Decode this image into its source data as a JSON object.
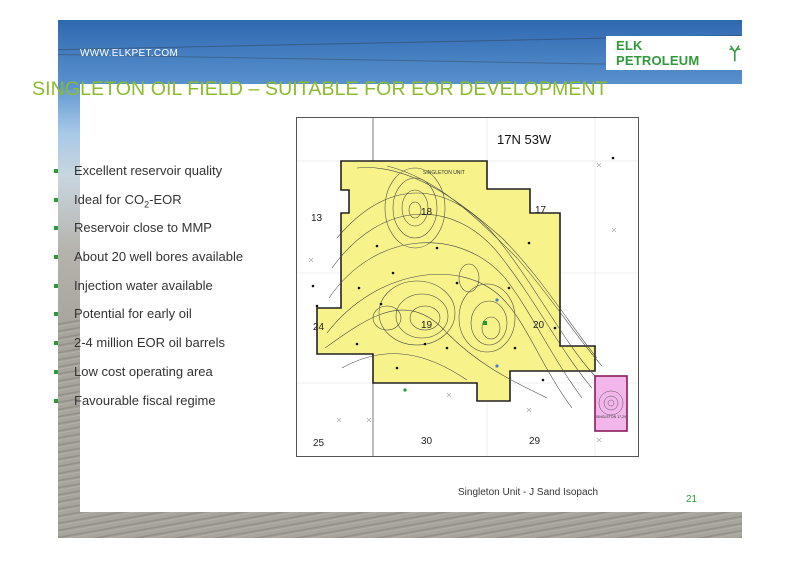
{
  "website": "WWW.ELKPET.COM",
  "logo": {
    "text": "ELK PETROLEUM"
  },
  "title": "SINGLETON OIL FIELD – SUITABLE FOR EOR DEVELOPMENT",
  "bullets": {
    "b0": "Excellent reservoir quality",
    "b1_pre": "Ideal for CO",
    "b1_sub": "2",
    "b1_post": "-EOR",
    "b2": "Reservoir close to MMP",
    "b3": "About 20 well bores available",
    "b4": "Injection water available",
    "b5": "Potential for early oil",
    "b6": "2-4 million EOR oil barrels",
    "b7": "Low cost operating area",
    "b8": "Favourable fiscal regime"
  },
  "map": {
    "township": "17N 53W",
    "unit_label": "SINGLETON UNIT",
    "sections": {
      "s13": "13",
      "s18": "18",
      "s17": "17",
      "s24": "24",
      "s19": "19",
      "s20": "20",
      "s25": "25",
      "s30": "30",
      "s29": "29"
    },
    "inset_label": "SINGLETON 17-29"
  },
  "caption": "Singleton Unit - J Sand Isopach",
  "page_number": "21",
  "colors": {
    "title_green": "#8cbb2d",
    "brand_green": "#2e9a3c",
    "unit_fill": "#f7f28a",
    "inset_fill": "#f2b6ea"
  }
}
